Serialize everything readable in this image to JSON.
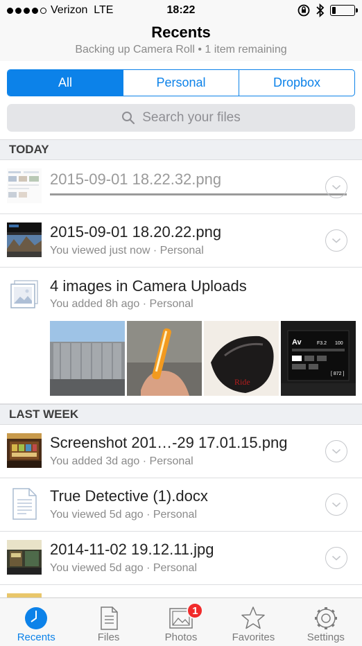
{
  "status_bar": {
    "carrier": "Verizon",
    "network": "LTE",
    "time": "18:22",
    "battery_level": 0.18
  },
  "header": {
    "title": "Recents",
    "subtitle": "Backing up Camera Roll • 1 item remaining"
  },
  "filter_tabs": [
    {
      "label": "All",
      "active": true
    },
    {
      "label": "Personal",
      "active": false
    },
    {
      "label": "Dropbox",
      "active": false
    }
  ],
  "search": {
    "placeholder": "Search your files"
  },
  "sections": {
    "today": "TODAY",
    "last_week": "LAST WEEK"
  },
  "today_items": [
    {
      "title": "2015-09-01 18.22.32.png",
      "subtitle": "",
      "uploading": true
    },
    {
      "title": "2015-09-01 18.20.22.png",
      "subtitle": "You viewed just now · Personal"
    },
    {
      "title": "4 images in Camera Uploads",
      "subtitle": "You added 8h ago · Personal"
    }
  ],
  "last_week_items": [
    {
      "title": "Screenshot 201…-29 17.01.15.png",
      "subtitle": "You added 3d ago · Personal"
    },
    {
      "title": "True Detective (1).docx",
      "subtitle": "You viewed 5d ago · Personal"
    },
    {
      "title": "2014-11-02 19.12.11.jpg",
      "subtitle": "You viewed 5d ago · Personal"
    }
  ],
  "tab_bar": [
    {
      "label": "Recents",
      "icon": "clock-icon",
      "active": true
    },
    {
      "label": "Files",
      "icon": "file-icon",
      "active": false
    },
    {
      "label": "Photos",
      "icon": "photo-icon",
      "active": false,
      "badge": "1"
    },
    {
      "label": "Favorites",
      "icon": "star-icon",
      "active": false
    },
    {
      "label": "Settings",
      "icon": "gear-icon",
      "active": false
    }
  ],
  "colors": {
    "accent": "#0c82e9",
    "badge": "#f12b2b"
  }
}
